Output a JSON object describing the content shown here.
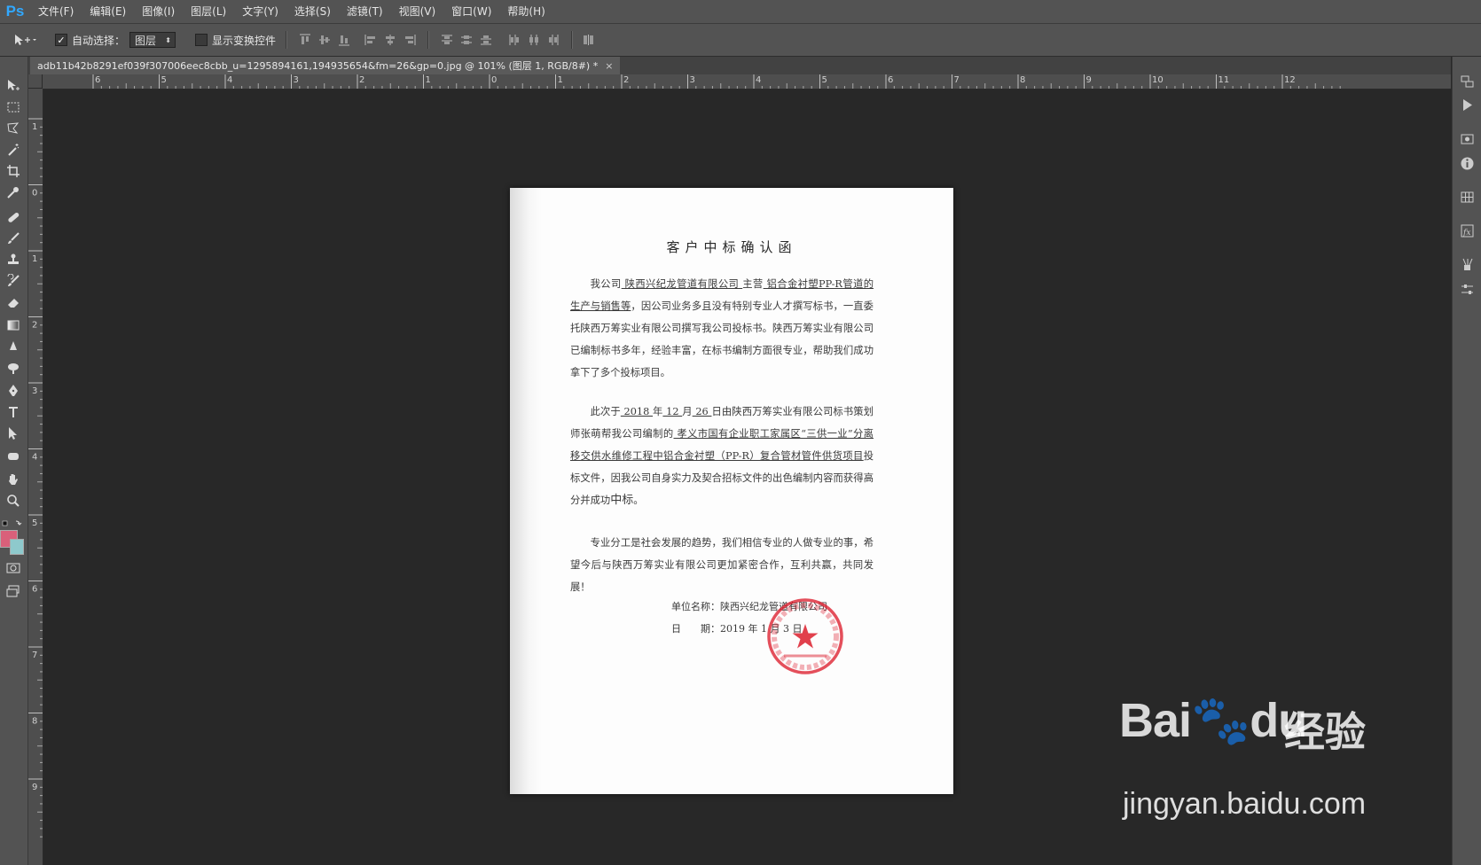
{
  "app": {
    "logo": "Ps"
  },
  "menu": [
    "文件(F)",
    "编辑(E)",
    "图像(I)",
    "图层(L)",
    "文字(Y)",
    "选择(S)",
    "滤镜(T)",
    "视图(V)",
    "窗口(W)",
    "帮助(H)"
  ],
  "options": {
    "auto_select_label": "自动选择：",
    "auto_select_checked": "✓",
    "auto_select_value": "图层",
    "show_transform_label": "显示变换控件"
  },
  "document_tab": {
    "title": "adb11b42b8291ef039f307006eec8cbb_u=1295894161,194935654&fm=26&gp=0.jpg @ 101% (图层 1, RGB/8#) *",
    "close": "×"
  },
  "ruler": {
    "top_labels": [
      "6",
      "5",
      "4",
      "3",
      "2",
      "1",
      "0",
      "1",
      "2",
      "3",
      "4",
      "5",
      "6",
      "7",
      "8",
      "9",
      "10",
      "11",
      "12"
    ],
    "left_labels": [
      "1",
      "0",
      "1",
      "2",
      "3",
      "4",
      "5",
      "6",
      "7",
      "8",
      "9"
    ]
  },
  "colors": {
    "foreground": "#d9607a",
    "background": "#8ec9cc",
    "accent": "#31a8ff"
  },
  "letter": {
    "title": "客户中标确认函",
    "p1": {
      "a": "我公司",
      "company": " 陕西兴纪龙管道有限公司 ",
      "b": "主营",
      "product": " 铝合金衬塑PP-R管道的生产与销售等",
      "c": "，因公司业务多且没有特别专业人才撰写标书，一直委托陕西万筹实业有限公司撰写我公司投标书。陕西万筹实业有限公司已编制标书多年，经验丰富，在标书编制方面很专业，帮助我们成功拿下了多个投标项目。"
    },
    "p2": {
      "a": "此次于",
      "year": " 2018 ",
      "b": "年",
      "month": " 12 ",
      "c": "月",
      "day": " 26 ",
      "d": "日由陕西万筹实业有限公司标书策划师张萌帮我公司编制的",
      "project": " 孝义市国有企业职工家属区“三供一业”分离移交供水维修工程中铝合金衬塑（PP-R）复合管材管件供货项目",
      "e": "投标文件，因我公司自身实力及契合招标文件的出色编制内容而获得高分并成功",
      "f": "中标",
      "g": "。"
    },
    "p3": "专业分工是社会发展的趋势，我们相信专业的人做专业的事，希望今后与陕西万筹实业有限公司更加紧密合作，互利共赢，共同发展！",
    "sign_label": "单位名称：",
    "sign_value": "陕西兴纪龙管道有限公司",
    "date_label": "日　　期：",
    "date_value": "2019 年 1 月 3 日"
  },
  "watermark": {
    "logo": "Bai",
    "logo2": "du",
    "cn": "经验",
    "url": "jingyan.baidu.com"
  }
}
